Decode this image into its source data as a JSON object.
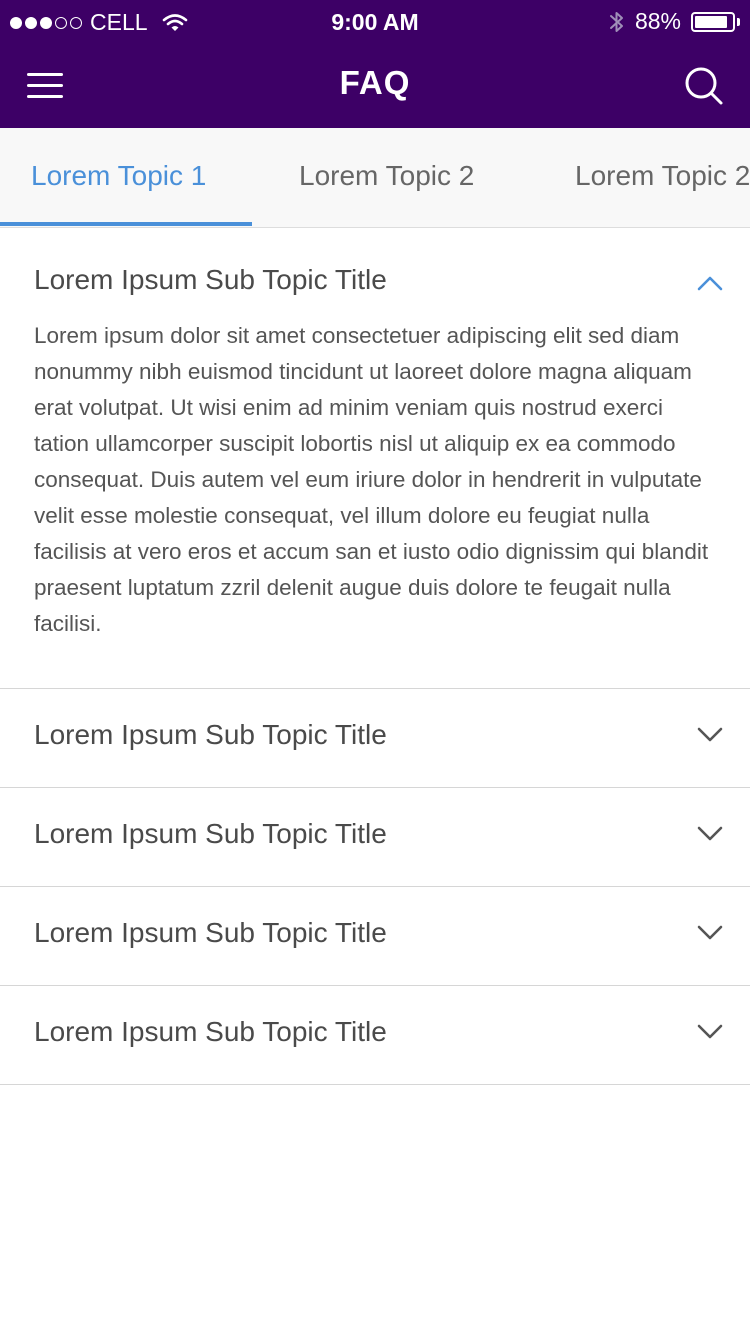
{
  "status_bar": {
    "signal_dots": [
      true,
      true,
      true,
      false,
      false
    ],
    "carrier": "CELL",
    "time": "9:00 AM",
    "battery_percent": "88%",
    "battery_level": 0.88
  },
  "nav": {
    "title": "FAQ",
    "menu_icon": "hamburger-menu-icon",
    "search_icon": "search-icon"
  },
  "tabs": [
    {
      "label": "Lorem Topic 1",
      "active": true
    },
    {
      "label": "Lorem Topic 2",
      "active": false
    },
    {
      "label": "Lorem Topic 2",
      "active": false
    }
  ],
  "faq": [
    {
      "title": "Lorem Ipsum Sub Topic Title",
      "expanded": true,
      "body": "Lorem ipsum dolor sit amet consectetuer adipiscing elit sed diam nonummy nibh euismod tincidunt ut laoreet dolore magna aliquam erat volutpat. Ut wisi enim ad minim veniam quis nostrud exerci tation ullamcorper suscipit lobortis nisl ut aliquip ex ea commodo consequat. Duis autem vel eum iriure dolor in hendrerit in vulputate velit esse molestie consequat, vel illum dolore eu feugiat nulla facilisis at vero eros et accum san et iusto odio dignissim qui blandit praesent luptatum zzril delenit augue duis dolore te feugait nulla facilisi."
    },
    {
      "title": "Lorem Ipsum Sub Topic Title",
      "expanded": false
    },
    {
      "title": "Lorem Ipsum Sub Topic Title",
      "expanded": false
    },
    {
      "title": "Lorem Ipsum Sub Topic Title",
      "expanded": false
    },
    {
      "title": "Lorem Ipsum Sub Topic Title",
      "expanded": false
    }
  ],
  "colors": {
    "header_bg": "#3d0066",
    "accent": "#4a90d9",
    "tab_bar_bg": "#f8f8f8",
    "text": "#4a4a4a",
    "chevron_collapsed": "#555555"
  }
}
